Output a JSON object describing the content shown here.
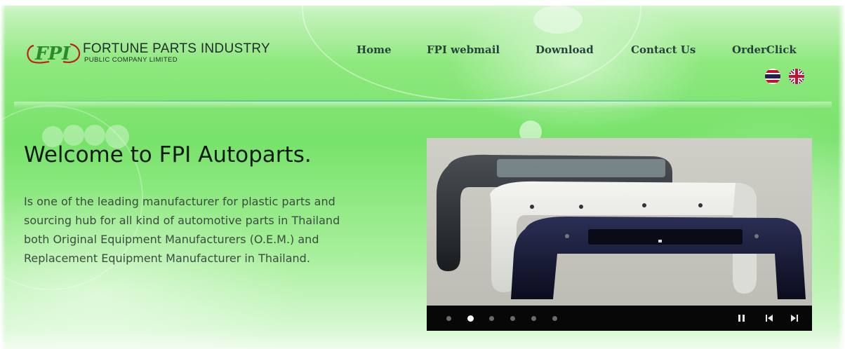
{
  "brand": {
    "logo_mark": "FPI",
    "name": "FORTUNE  PARTS  INDUSTRY",
    "subtitle": "PUBLIC COMPANY LIMITED",
    "colors": {
      "logo_green": "#2a8a2e",
      "logo_red": "#c0201a",
      "text_dark": "#1e2d2a"
    }
  },
  "nav": {
    "items": [
      {
        "label": "Home"
      },
      {
        "label": "FPI webmail"
      },
      {
        "label": "Download"
      },
      {
        "label": "Contact Us"
      },
      {
        "label": "OrderClick"
      }
    ]
  },
  "languages": [
    {
      "icon": "thai-flag-icon",
      "lang": "th"
    },
    {
      "icon": "uk-flag-icon",
      "lang": "en"
    }
  ],
  "hero": {
    "title": "Welcome to FPI Autoparts.",
    "description_lines": [
      "Is one of the leading manufacturer for plastic parts and",
      "sourcing hub for all kind of automotive parts in Thailand",
      "both Original Equipment Manufacturers (O.E.M.) and",
      "Replacement Equipment Manufacturer in Thailand."
    ]
  },
  "slider": {
    "slide_count": 6,
    "active_index": 1,
    "controls": [
      "pause-icon",
      "previous-icon",
      "next-icon"
    ],
    "colors": {
      "bar": "#070707",
      "dot": "#6b6b6b",
      "dot_active": "#ffffff"
    }
  },
  "theme": {
    "accent_green": "#77e26a",
    "nav_text": "#26443a"
  }
}
